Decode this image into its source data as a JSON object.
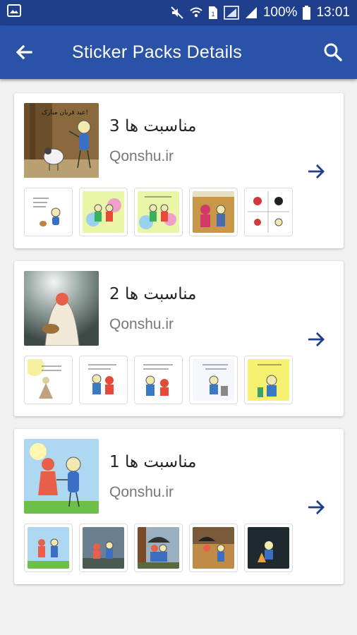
{
  "status_bar": {
    "battery": "100%",
    "time": "13:01",
    "icons": [
      "gallery-icon",
      "mute-icon",
      "wifi-icon",
      "sim-icon",
      "data-icon",
      "signal-icon",
      "battery-icon"
    ]
  },
  "app_bar": {
    "title": "Sticker Packs Details",
    "icons": [
      "back-arrow-icon",
      "search-icon"
    ]
  },
  "colors": {
    "status_bar": "#1f3e8c",
    "app_bar": "#2a53a7",
    "accent_arrow": "#1f3e8c",
    "background": "#f1f1f1"
  },
  "packs": [
    {
      "name": "مناسبت ها 3",
      "publisher": "Qonshu.ir",
      "tray_text": "عید قربان مبارک!"
    },
    {
      "name": "مناسبت ها 2",
      "publisher": "Qonshu.ir",
      "tray_text": ""
    },
    {
      "name": "مناسبت ها 1",
      "publisher": "Qonshu.ir",
      "tray_text": ""
    }
  ]
}
